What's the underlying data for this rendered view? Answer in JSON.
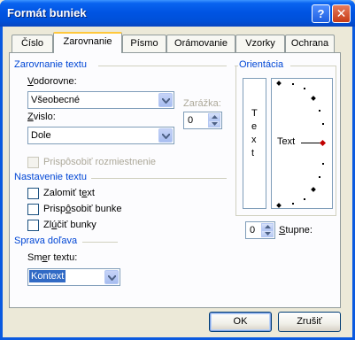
{
  "window": {
    "title": "Formát buniek"
  },
  "titlebar": {
    "help_label": "?",
    "close_label": "✕"
  },
  "tabs": [
    {
      "label": "Číslo"
    },
    {
      "label": "Zarovnanie"
    },
    {
      "label": "Písmo"
    },
    {
      "label": "Orámovanie"
    },
    {
      "label": "Vzorky"
    },
    {
      "label": "Ochrana"
    }
  ],
  "alignment": {
    "group_label": "Zarovnanie textu",
    "horizontal_label": "Vodorovne:",
    "horizontal_value": "Všeobecné",
    "vertical_label": "Zvislo:",
    "vertical_value": "Dole",
    "indent_label": "Zarážka:",
    "indent_value": "0",
    "justify_distributed_label": "Prispôsobiť rozmiestnenie"
  },
  "text_control": {
    "group_label": "Nastavenie textu",
    "wrap_label": "Zalomiť text",
    "shrink_label": "Prispôsobiť bunke",
    "merge_label": "Zlúčiť bunky"
  },
  "rtl": {
    "group_label": "Sprava doľava",
    "direction_label": "Smer textu:",
    "direction_value": "Kontext"
  },
  "orientation": {
    "group_label": "Orientácia",
    "vertical_text": [
      "T",
      "e",
      "x",
      "t"
    ],
    "rotate_text": "Text",
    "degrees_value": "0",
    "degrees_label": "Stupne:"
  },
  "buttons": {
    "ok": "OK",
    "cancel": "Zrušiť"
  },
  "colors": {
    "title_blue": "#0054e3",
    "group_label": "#0046d5",
    "selection": "#316ac5",
    "active_tab": "#ffc83c"
  }
}
